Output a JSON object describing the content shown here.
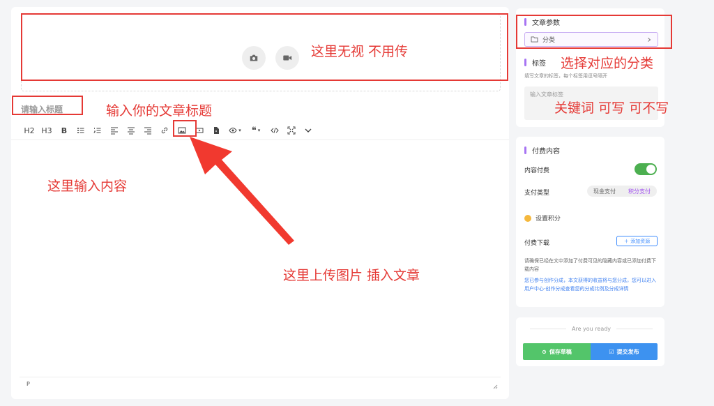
{
  "editor": {
    "title_placeholder": "请输入标题",
    "toolbar": {
      "h2": "H2",
      "h3": "H3",
      "bold": "B",
      "quote": "❝",
      "caret": "▾"
    },
    "status_tag": "P"
  },
  "sidebar": {
    "article_params": {
      "heading": "文章参数",
      "category_label": "分类"
    },
    "tags": {
      "heading": "标签",
      "help": "填写文章的标签，每个标签用逗号隔开",
      "placeholder": "输入文章标签"
    },
    "paid": {
      "heading": "付费内容",
      "content_paid_label": "内容付费",
      "toggle_on": true,
      "pay_type_label": "支付类型",
      "pay_options": [
        "现金支付",
        "积分支付"
      ],
      "pay_selected": "积分支付",
      "points_label": "设置积分",
      "download_label": "付费下载",
      "add_resource": "＋ 添加资源",
      "note": "请确保已经在文中添加了付费可见的隐藏内容或已添加付费下载内容",
      "creator_note": "您已参与创作分成，本文获得的收益将与您分成，您可以进入用户中心-创作分成查看您的分成比例及分成详情"
    },
    "publish": {
      "ready_text": "Are you ready",
      "save_draft": "保存草稿",
      "submit": "提交发布"
    }
  },
  "annotations": {
    "cover": "这里无视  不用传",
    "title": "输入你的文章标题",
    "content": "这里输入内容",
    "upload": "这里上传图片 插入文章",
    "category": "选择对应的分类",
    "keywords": "关键词  可写  可不写"
  },
  "colors": {
    "annotation_red": "#e53935",
    "accent_purple": "#a774f3",
    "toggle_green": "#4caf50",
    "save_green": "#53c56a",
    "submit_blue": "#3d92f0"
  }
}
